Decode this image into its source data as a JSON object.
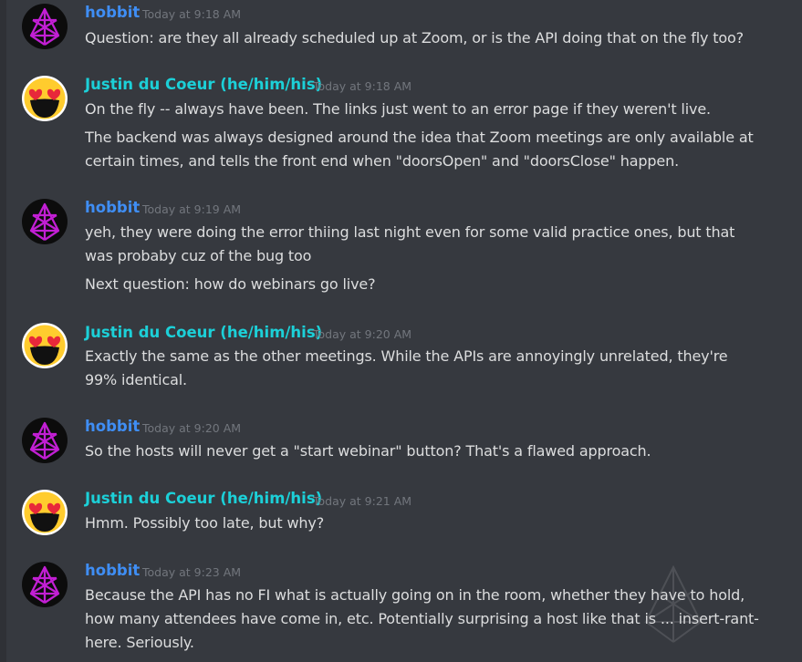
{
  "colors": {
    "background": "#36393f",
    "hobbit_name": "#3f8ef5",
    "justin_name": "#1cd0d8",
    "timestamp": "#72767d",
    "message_text": "#dcddde"
  },
  "messages": [
    {
      "author": "hobbit",
      "timestamp": "Today at 9:18 AM",
      "avatar_icon": "pentagram-avatar-icon",
      "lines": [
        "Question: are they all already scheduled up at Zoom, or is the API doing that on the fly too?"
      ]
    },
    {
      "author": "Justin du Coeur (he/him/his)",
      "timestamp": "Today at 9:18 AM",
      "avatar_icon": "heart-eyes-emoji-avatar-icon",
      "lines": [
        "On the fly -- always have been.  The links just went to an error page if they weren't live.",
        "The backend was always designed around the idea that Zoom meetings are only available at",
        "certain times, and tells the front end when \"doorsOpen\" and \"doorsClose\" happen."
      ]
    },
    {
      "author": "hobbit",
      "timestamp": "Today at 9:19 AM",
      "avatar_icon": "pentagram-avatar-icon",
      "lines": [
        "yeh, they were doing the error thiing last night even for some valid practice ones, but that",
        "was probaby cuz of the bug too",
        "Next question: how do webinars go live?"
      ]
    },
    {
      "author": "Justin du Coeur (he/him/his)",
      "timestamp": "Today at 9:20 AM",
      "avatar_icon": "heart-eyes-emoji-avatar-icon",
      "lines": [
        "Exactly the same as the other meetings.  While the APIs are annoyingly unrelated, they're",
        "99% identical."
      ]
    },
    {
      "author": "hobbit",
      "timestamp": "Today at 9:20 AM",
      "avatar_icon": "pentagram-avatar-icon",
      "lines": [
        "So the hosts will never get a \"start webinar\" button?  That's a flawed approach."
      ]
    },
    {
      "author": "Justin du Coeur (he/him/his)",
      "timestamp": "Today at 9:21 AM",
      "avatar_icon": "heart-eyes-emoji-avatar-icon",
      "lines": [
        "Hmm.  Possibly too late, but why?"
      ]
    },
    {
      "author": "hobbit",
      "timestamp": "Today at 9:23 AM",
      "avatar_icon": "pentagram-avatar-icon",
      "lines": [
        "Because the API has no FI what is actually going on in the room, whether they have to hold,",
        "how many attendees have come in, etc.  Potentially surprising a host like that is ... insert-rant-",
        "here.  Seriously."
      ]
    }
  ]
}
